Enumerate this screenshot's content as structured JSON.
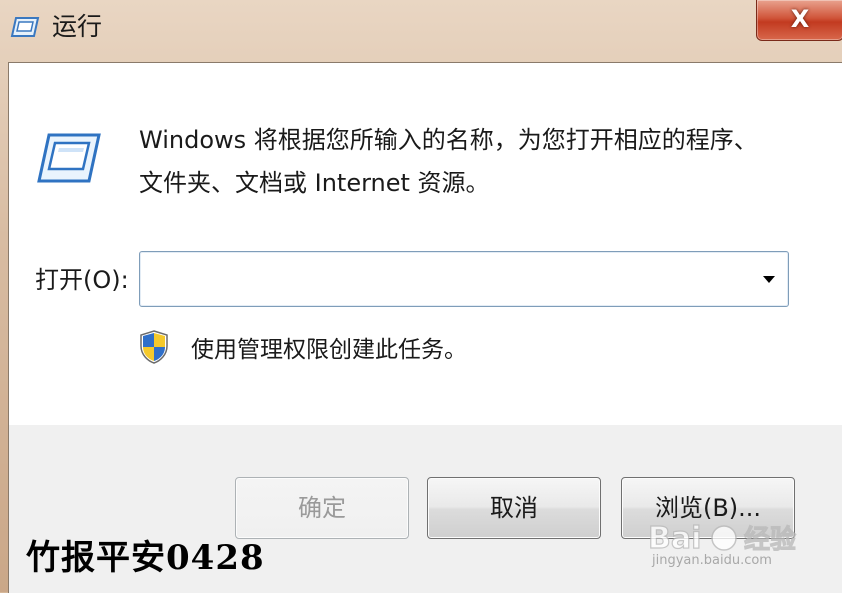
{
  "window": {
    "title": "运行",
    "close_label": "X"
  },
  "dialog": {
    "description_line1": "Windows 将根据您所输入的名称，为您打开相应的程序、",
    "description_line2": "文件夹、文档或 Internet 资源。",
    "open_label": "打开(O):",
    "open_value": "",
    "admin_note": "使用管理权限创建此任务。"
  },
  "buttons": {
    "ok": "确定",
    "cancel": "取消",
    "browse": "浏览(B)..."
  },
  "watermark": {
    "left_text": "竹报平安0428",
    "baidu_brand": "Baidu经验",
    "baidu_url": "jingyan.baidu.com"
  },
  "icons": {
    "title": "run-icon",
    "main": "run-icon",
    "shield": "uac-shield-icon",
    "combo": "dropdown-arrow-icon",
    "close": "close-icon"
  }
}
